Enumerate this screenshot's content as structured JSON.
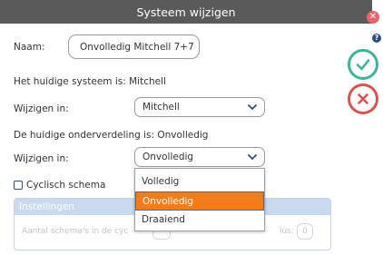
{
  "dialog": {
    "title": "Systeem wijzigen"
  },
  "form": {
    "name_label": "Naam:",
    "name_value": "Onvolledig Mitchell 7+7",
    "current_system": "Het huidige systeem is: Mitchell",
    "change_label_1": "Wijzigen in:",
    "system_select_value": "Mitchell",
    "current_division": "De huidige onderverdeling is: Onvolledig",
    "change_label_2": "Wijzigen in:",
    "division_select_value": "Onvolledig",
    "cyclic_label": "Cyclisch schema",
    "cyclic_checked": false
  },
  "settings": {
    "title": "Instellingen",
    "schemas_label": "Aantal schema's in de cyc",
    "cycle_label": "lus:",
    "cycle_value": "0"
  },
  "dropdown": {
    "options": [
      "Volledig",
      "Onvolledig",
      "Draaiend"
    ],
    "selected": "Onvolledig"
  },
  "colors": {
    "titlebar": "#5a5a5a",
    "ok": "#3bb59a",
    "cancel": "#d9534f",
    "selected_option": "#f07c1c",
    "settings_header": "#c9d9ef"
  },
  "icons": {
    "ok": "check-icon",
    "cancel": "x-icon",
    "close": "close-icon",
    "help": "help-icon"
  }
}
